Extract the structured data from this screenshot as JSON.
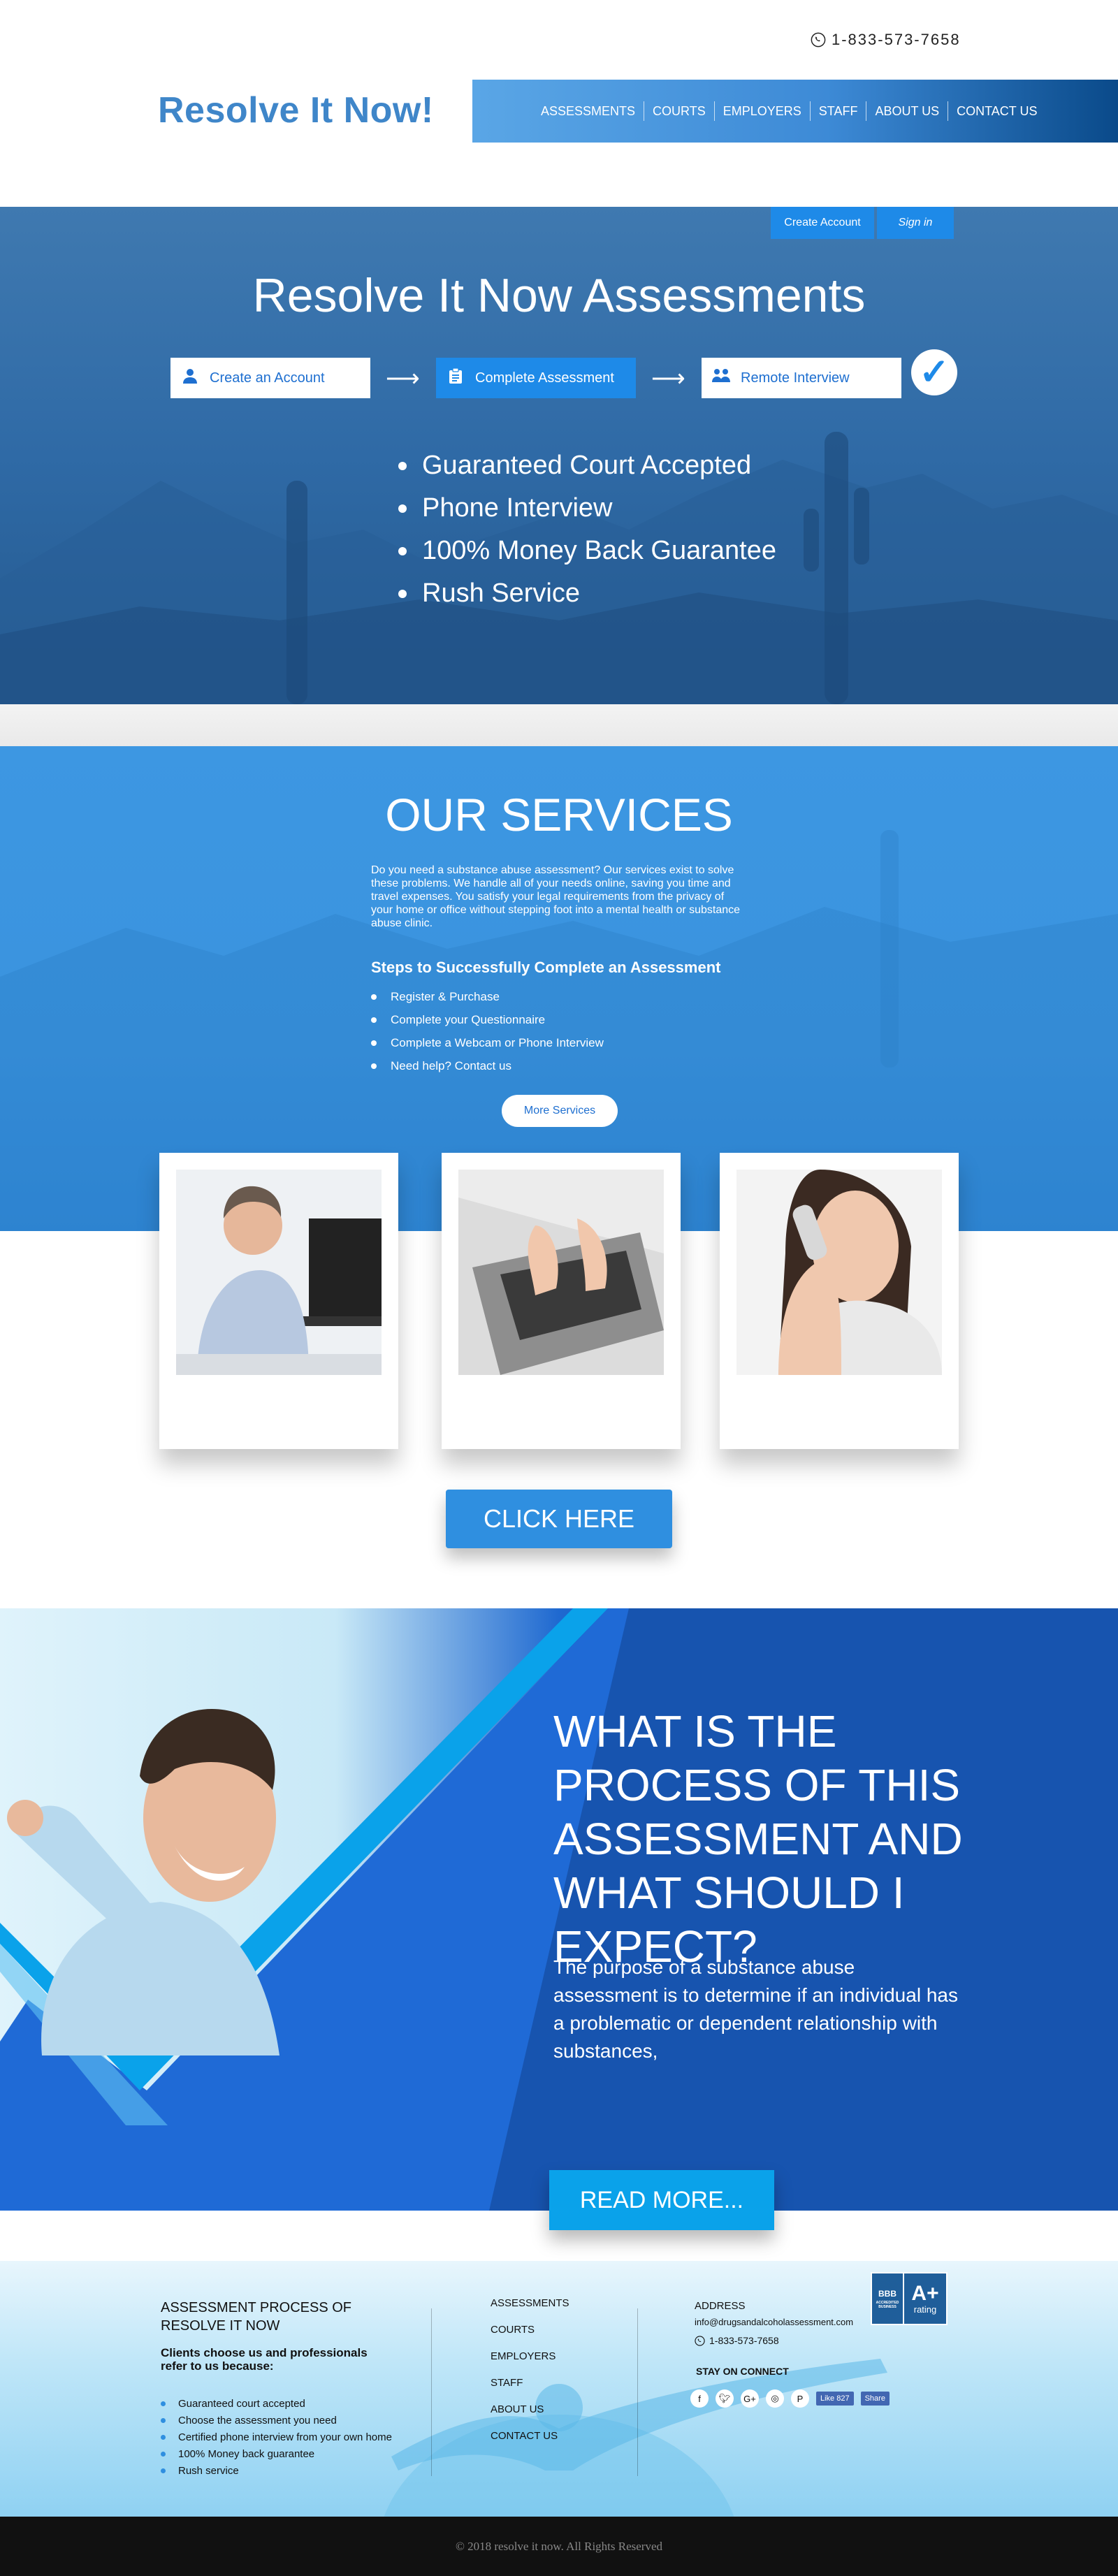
{
  "header": {
    "phone": "1-833-573-7658",
    "logo": "Resolve It Now!",
    "nav": [
      "ASSESSMENTS",
      "COURTS",
      "EMPLOYERS",
      "STAFF",
      "ABOUT US",
      "CONTACT US"
    ]
  },
  "hero": {
    "create_account": "Create Account",
    "sign_in": "Sign in",
    "title": "Resolve It Now Assessments",
    "steps": [
      "Create an Account",
      "Complete Assessment",
      "Remote Interview"
    ],
    "bullets": [
      "Guaranteed Court Accepted",
      "Phone Interview",
      "100% Money Back Guarantee",
      "Rush Service"
    ]
  },
  "services": {
    "title": "OUR SERVICES",
    "text": "Do you need a substance abuse assessment?  Our services exist to solve these problems.  We handle all of your needs online, saving you time and travel expenses.  You satisfy your legal requirements from the privacy of your home or office without stepping foot into a mental health or substance abuse clinic.",
    "steps_title": "Steps to Successfully Complete an Assessment",
    "steps": [
      "Register & Purchase",
      "Complete your Questionnaire",
      "Complete a Webcam or Phone Interview",
      "Need help? Contact us"
    ],
    "more_button": "More Services",
    "click_here": "CLICK HERE"
  },
  "process": {
    "title": "WHAT IS THE PROCESS OF THIS ASSESSMENT AND WHAT SHOULD I EXPECT?",
    "text": "The purpose of a substance abuse assessment is to determine if an individual has a problematic or dependent relationship with substances,",
    "read_more": "READ MORE..."
  },
  "footer": {
    "title": "ASSESSMENT PROCESS OF RESOLVE IT NOW",
    "subtitle": "Clients choose us and professionals refer to us because:",
    "reasons": [
      "Guaranteed court accepted",
      "Choose the assessment you need",
      "Certified phone interview from your own home",
      "100% Money back guarantee",
      "Rush service"
    ],
    "links": [
      "ASSESSMENTS",
      "COURTS",
      "EMPLOYERS",
      "STAFF",
      "ABOUT US",
      "CONTACT US"
    ],
    "address_title": "ADDRESS",
    "email": "info@drugsandalcoholassessment.com",
    "phone": "1-833-573-7658",
    "stay_on_connect": "STAY ON CONNECT",
    "social_icons": [
      "facebook-icon",
      "twitter-icon",
      "google-plus-icon",
      "instagram-icon",
      "pinterest-icon"
    ],
    "fb_like": "Like 827",
    "fb_share": "Share",
    "bbb_logo": "BBB",
    "bbb_accredited": "ACCREDITED BUSINESS",
    "bbb_grade": "A+",
    "bbb_rating": "rating",
    "copyright": "© 2018 resolve it now. All Rights Reserved"
  },
  "colors": {
    "primary_blue": "#2f8fe0",
    "logo_blue": "#3f86c9",
    "dark_navy": "#050f24"
  }
}
